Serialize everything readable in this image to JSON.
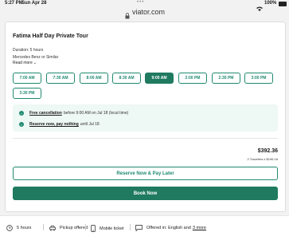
{
  "status_bar": {
    "time": "5:27 PM",
    "date": "Sun Apr 28",
    "battery": "100%"
  },
  "browser": {
    "url": "viator.com"
  },
  "tour": {
    "title": "Fatima Half Day Private Tour",
    "duration": "Duration: 5 hours",
    "vehicle": "Mercedes Benz or Similar",
    "read_more": "Read more"
  },
  "times": [
    "7:00 AM",
    "7:30 AM",
    "8:00 AM",
    "8:30 AM",
    "9:00 AM",
    "2:00 PM",
    "2:30 PM",
    "3:00 PM",
    "3:30 PM"
  ],
  "selected_time": "9:00 AM",
  "policy": {
    "cancel_link": "Free cancellation",
    "cancel_text": "before 9:00 AM on Jul 18 (local time)",
    "reserve_link": "Reserve now, pay nothing",
    "reserve_text": "until Jul 18"
  },
  "pricing": {
    "total": "$392.36",
    "detail": "2 Travelers x $196.18"
  },
  "actions": {
    "reserve_label": "Reserve Now & Pay Later",
    "book_label": "Book Now"
  },
  "features": {
    "duration": "5 hours",
    "pickup": "Pickup offered",
    "ticket": "Mobile ticket",
    "language": "Offered in: English and",
    "language_more": "3 more"
  },
  "colors": {
    "accent": "#1f7a60",
    "policy_bg": "#eef8f4"
  }
}
